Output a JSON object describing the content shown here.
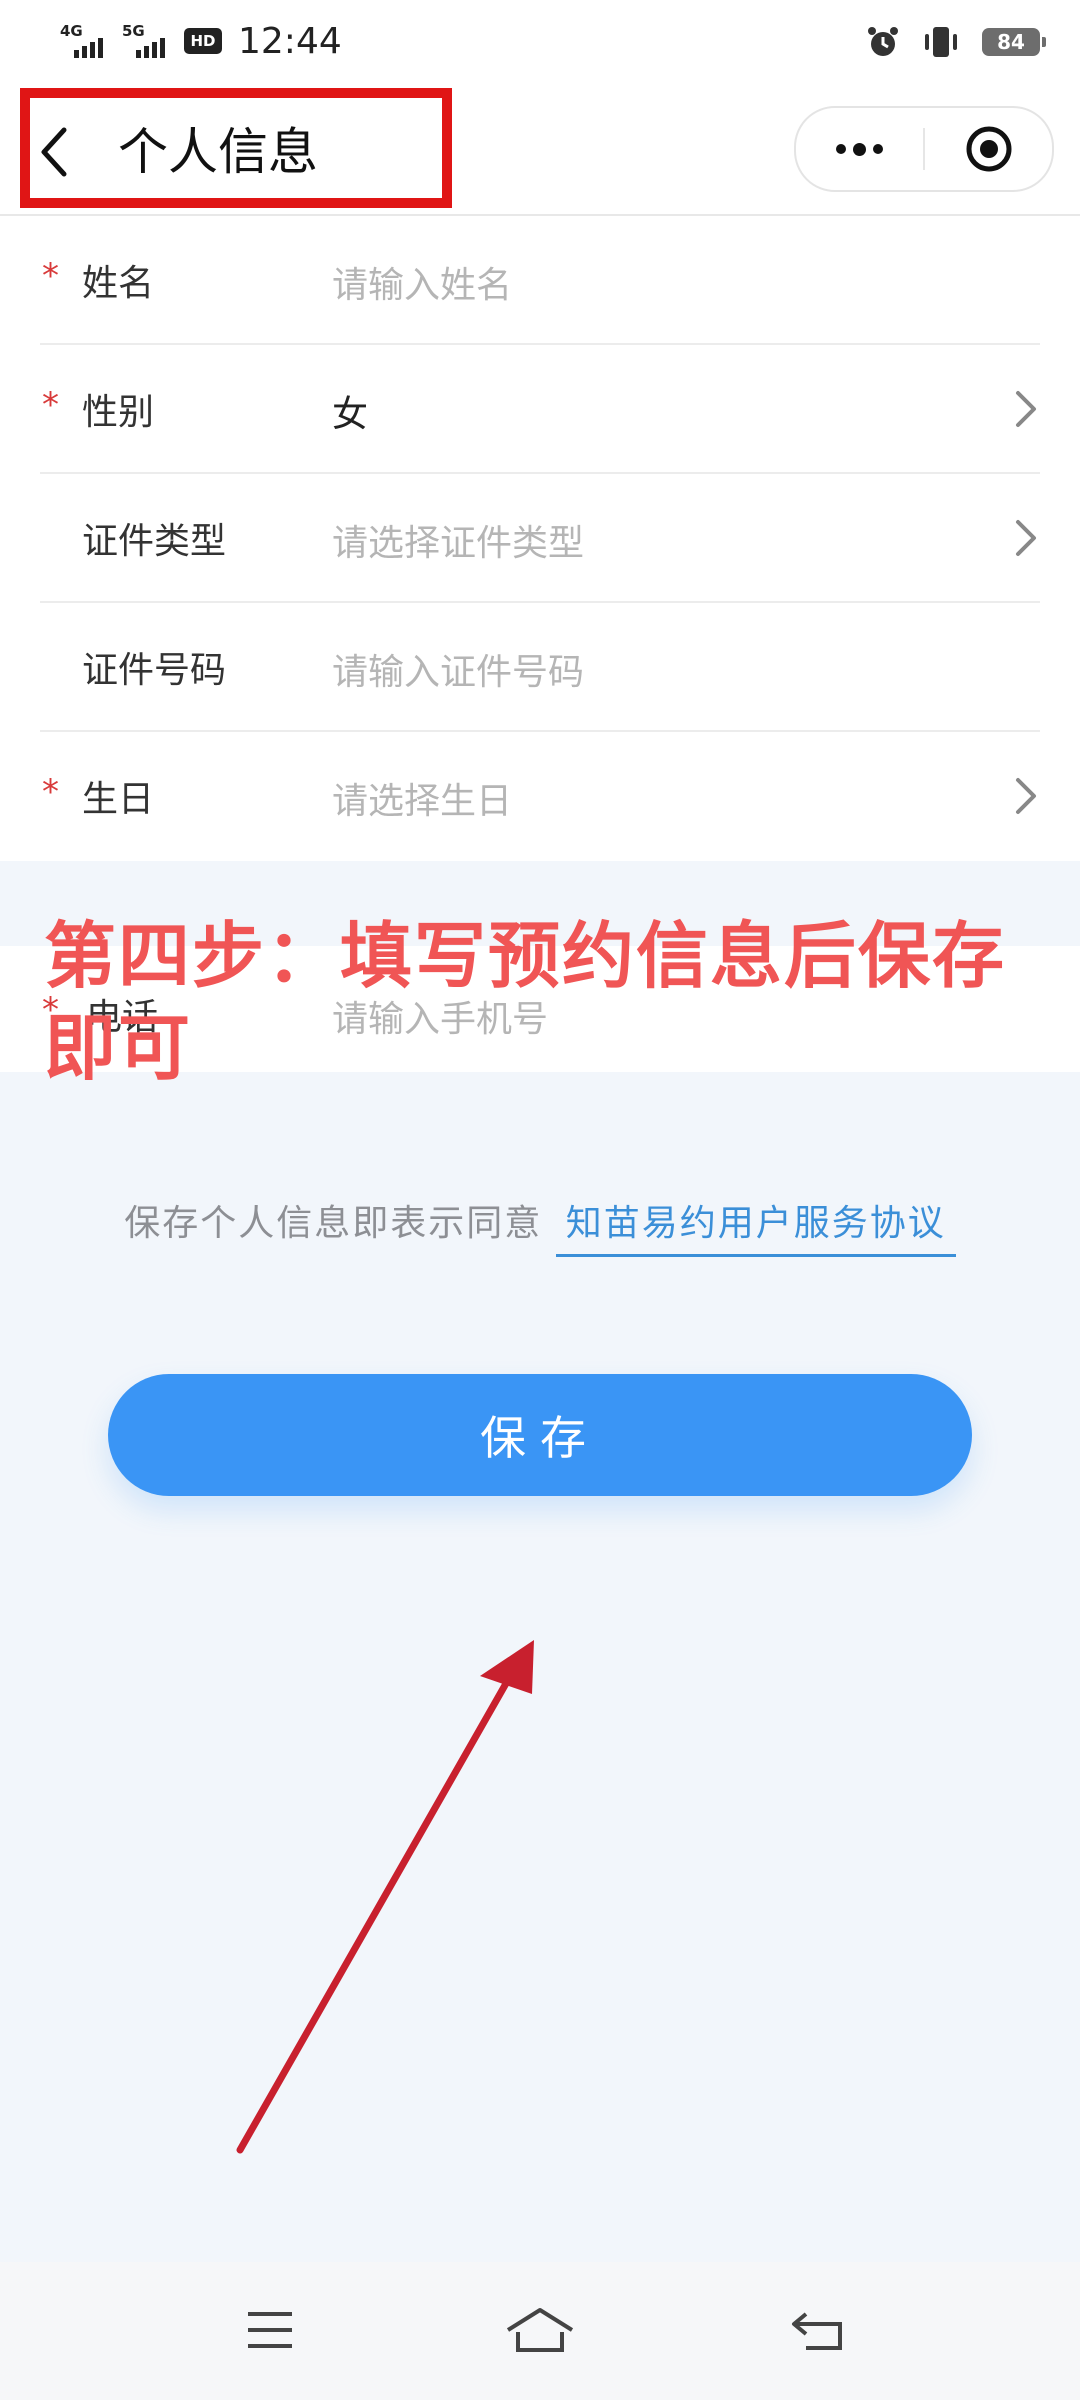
{
  "status_bar": {
    "net1": "4G",
    "net2": "5G",
    "hd": "HD",
    "time": "12:44",
    "battery": "84"
  },
  "nav": {
    "title": "个人信息"
  },
  "form": {
    "rows": [
      {
        "required": "*",
        "label": "姓名",
        "value": "请输入姓名"
      },
      {
        "required": "*",
        "label": "性别",
        "value": "女"
      },
      {
        "required": "",
        "label": "证件类型",
        "value": "请选择证件类型"
      },
      {
        "required": "",
        "label": "证件号码",
        "value": "请输入证件号码"
      },
      {
        "required": "*",
        "label": "生日",
        "value": "请选择生日"
      },
      {
        "required": "*",
        "label": "电话",
        "value": "请输入手机号"
      }
    ]
  },
  "agreement": {
    "text": "保存个人信息即表示同意",
    "link": "知苗易约用户服务协议"
  },
  "save_button": {
    "label": "保存"
  },
  "overlay": {
    "caption": "第四步：填写预约信息后保存即可"
  },
  "colors": {
    "accent": "#3a95f5",
    "required": "#d83a3a",
    "annotation": "#e01515",
    "arrow": "#c8202e",
    "background": "#f2f6fb"
  },
  "icons": {
    "back": "chevron-left-icon",
    "more": "more-dots-icon",
    "close": "target-circle-icon",
    "chevron": "chevron-right-icon",
    "alarm": "alarm-icon",
    "vibrate": "vibrate-icon",
    "menu": "menu-lines-icon",
    "home": "home-icon",
    "back_nav": "return-icon"
  }
}
